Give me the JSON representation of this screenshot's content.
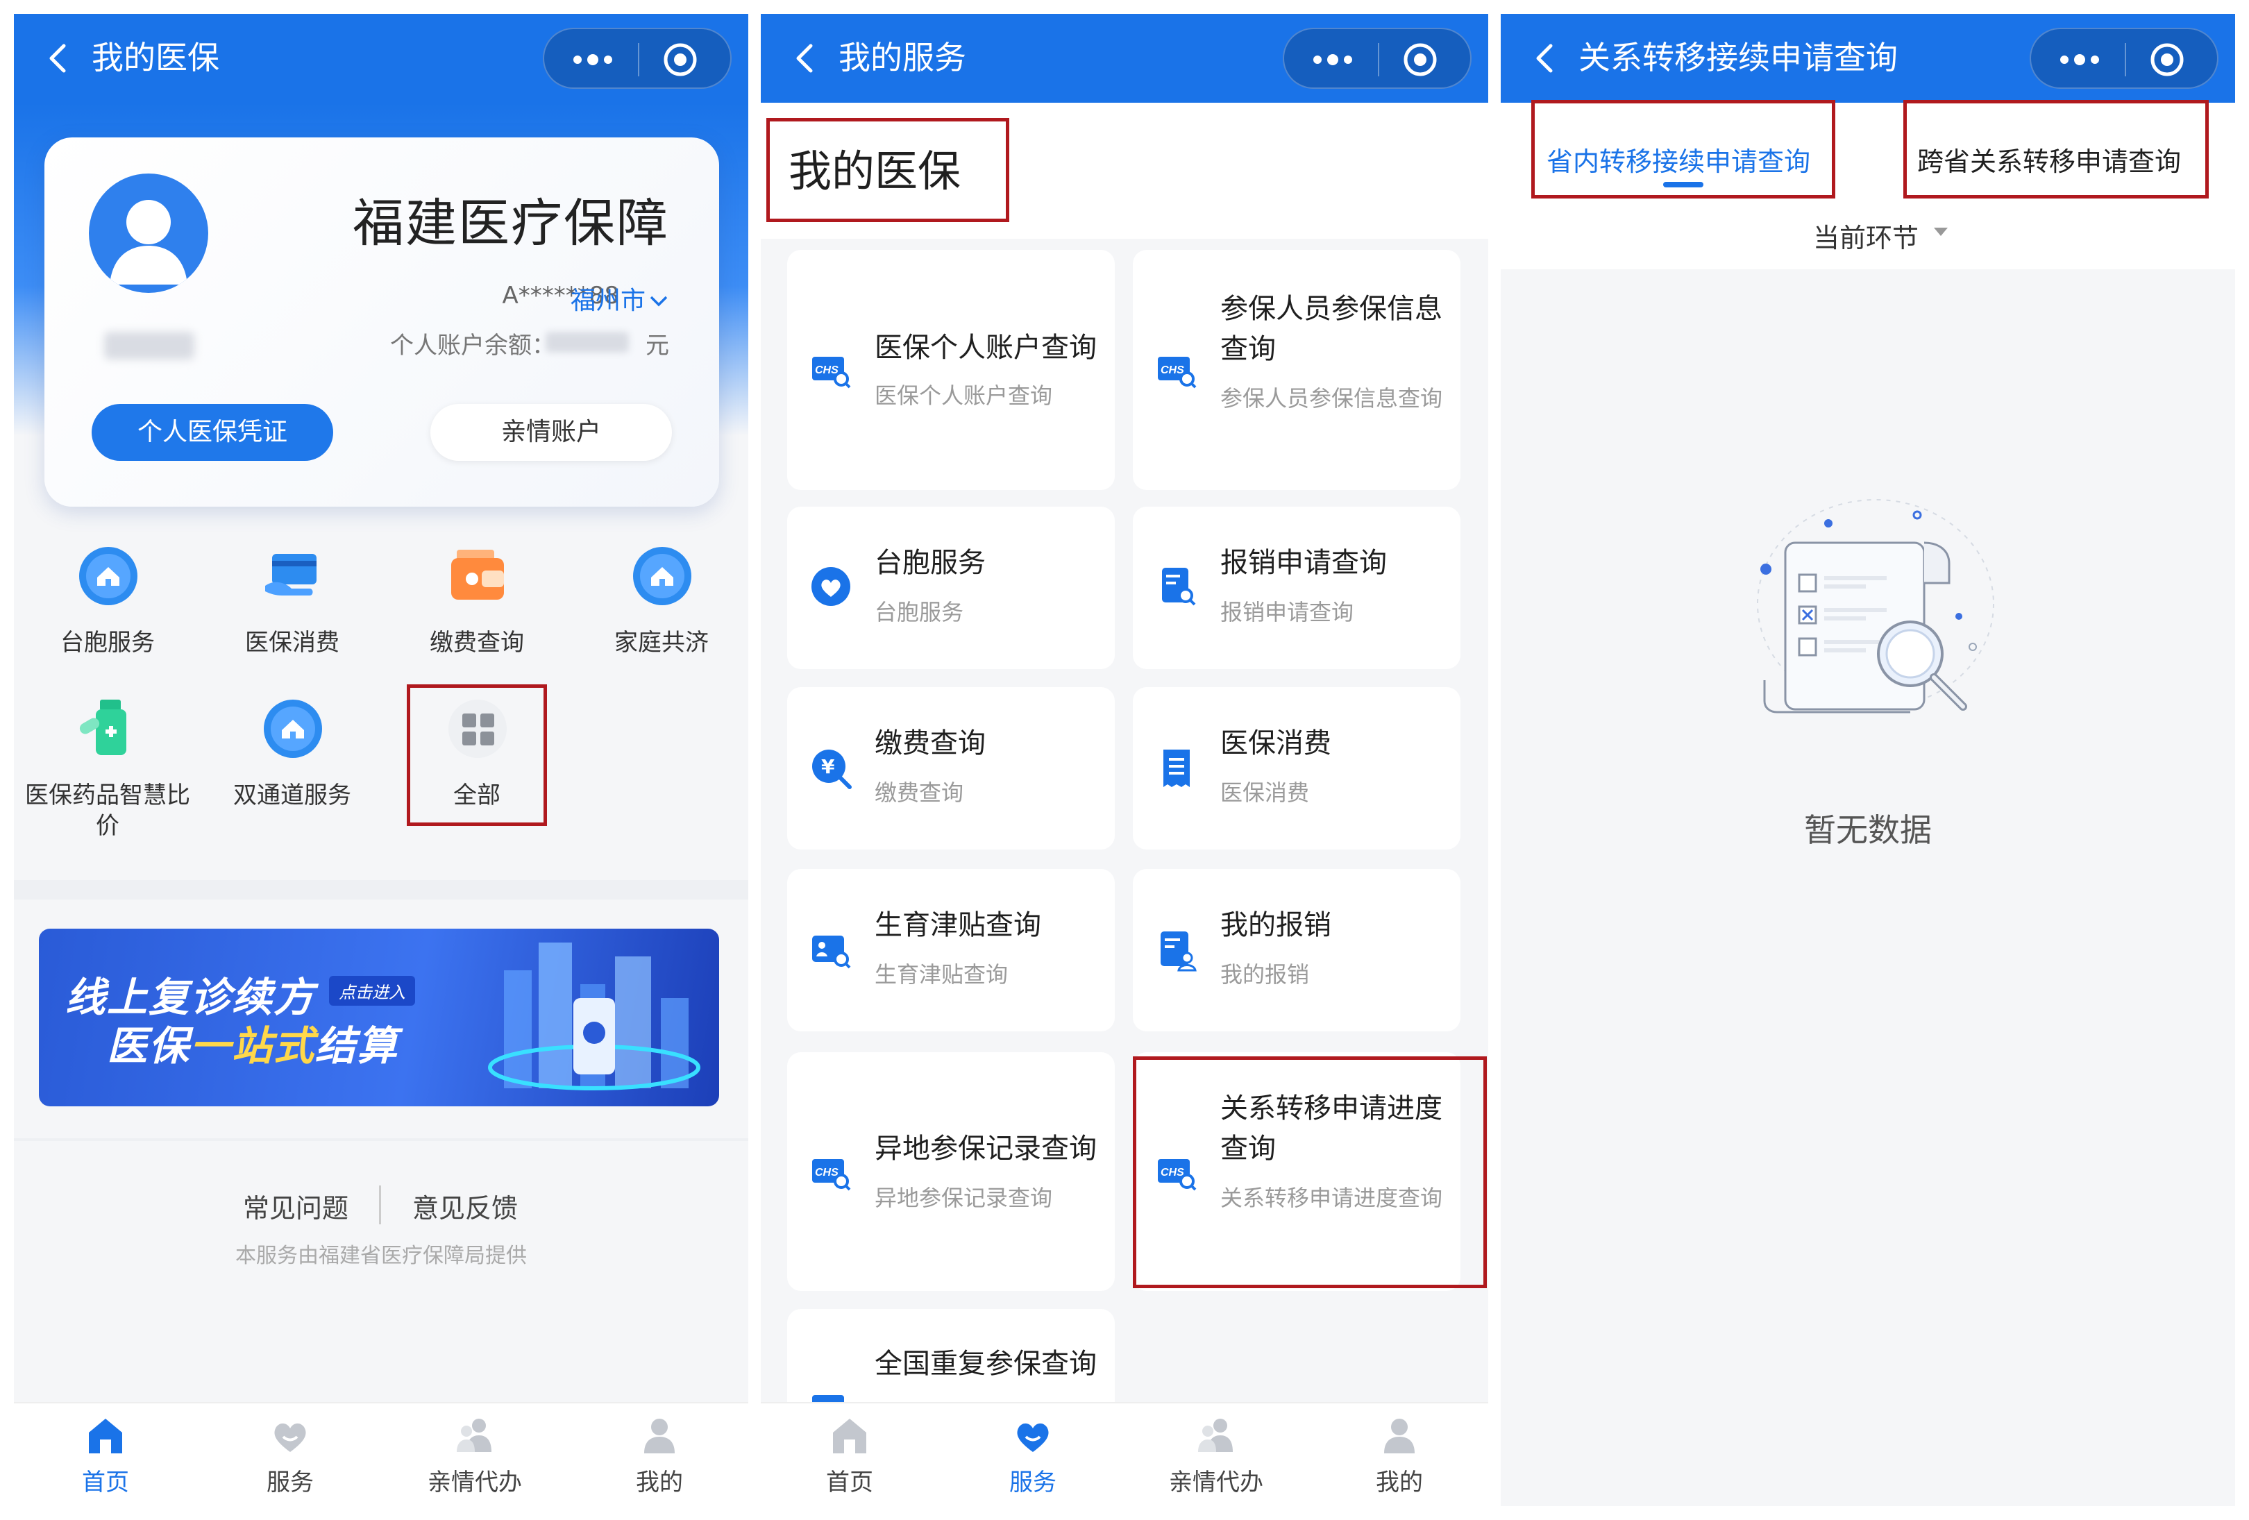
{
  "panel1": {
    "title": "我的医保",
    "card": {
      "title": "福建医疗保障",
      "id_masked": "A******88",
      "city": "福州市",
      "balance_label": "个人账户余额：",
      "balance_unit": "元",
      "primary_button": "个人医保凭证",
      "secondary_button": "亲情账户"
    },
    "grid": [
      {
        "label": "台胞服务",
        "icon": "home-icon"
      },
      {
        "label": "医保消费",
        "icon": "card-icon"
      },
      {
        "label": "缴费查询",
        "icon": "wallet-icon"
      },
      {
        "label": "家庭共济",
        "icon": "home-icon"
      },
      {
        "label": "医保药品智慧比价",
        "icon": "medicine-icon"
      },
      {
        "label": "双通道服务",
        "icon": "home-icon"
      },
      {
        "label": "全部",
        "icon": "grid-icon"
      }
    ],
    "banner": {
      "line1": "线上复诊续方",
      "tag": "点击进入",
      "line2_a": "医保",
      "line2_b": "一站式",
      "line2_c": "结算"
    },
    "footer": {
      "faq": "常见问题",
      "feedback": "意见反馈",
      "note": "本服务由福建省医疗保障局提供"
    },
    "tabs": [
      {
        "label": "首页",
        "active": true
      },
      {
        "label": "服务",
        "active": false
      },
      {
        "label": "亲情代办",
        "active": false
      },
      {
        "label": "我的",
        "active": false
      }
    ]
  },
  "panel2": {
    "title": "我的服务",
    "section_title": "我的医保",
    "services": [
      {
        "title": "医保个人账户查询",
        "sub": "医保个人账户查询",
        "icon": "chs-search-icon"
      },
      {
        "title": "参保人员参保信息查询",
        "sub": "参保人员参保信息查询",
        "icon": "chs-search-icon"
      },
      {
        "title": "台胞服务",
        "sub": "台胞服务",
        "icon": "heart-hands-icon"
      },
      {
        "title": "报销申请查询",
        "sub": "报销申请查询",
        "icon": "document-search-icon"
      },
      {
        "title": "缴费查询",
        "sub": "缴费查询",
        "icon": "yuan-search-icon"
      },
      {
        "title": "医保消费",
        "sub": "医保消费",
        "icon": "receipt-icon"
      },
      {
        "title": "生育津贴查询",
        "sub": "生育津贴查询",
        "icon": "baby-card-icon"
      },
      {
        "title": "我的报销",
        "sub": "我的报销",
        "icon": "document-user-icon"
      },
      {
        "title": "异地参保记录查询",
        "sub": "异地参保记录查询",
        "icon": "chs-search-icon"
      },
      {
        "title": "关系转移申请进度查询",
        "sub": "关系转移申请进度查询",
        "icon": "chs-search-icon"
      },
      {
        "title": "全国重复参保查询",
        "sub": "",
        "icon": "chs-search-icon"
      }
    ],
    "tabs": [
      {
        "label": "首页",
        "active": false
      },
      {
        "label": "服务",
        "active": true
      },
      {
        "label": "亲情代办",
        "active": false
      },
      {
        "label": "我的",
        "active": false
      }
    ]
  },
  "panel3": {
    "title": "关系转移接续申请查询",
    "tab_active": "省内转移接续申请查询",
    "tab_other": "跨省关系转移申请查询",
    "filter": "当前环节",
    "empty": "暂无数据"
  },
  "colors": {
    "brand": "#1a73e8",
    "highlight": "#b0191e"
  }
}
